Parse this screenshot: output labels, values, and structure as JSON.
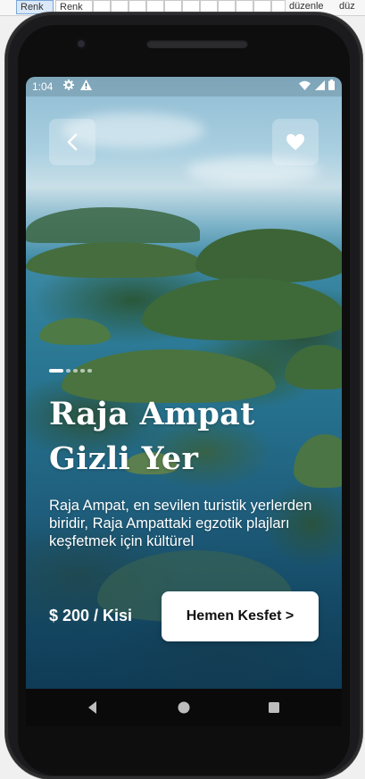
{
  "host": {
    "cells": [
      "Renk",
      "Renk",
      "",
      "",
      "",
      "",
      "",
      "",
      "",
      "",
      "",
      "",
      "",
      "",
      "düzenle",
      "",
      "düz"
    ]
  },
  "status_bar": {
    "time": "1:04",
    "left_icons": [
      "gear-icon",
      "alert-icon"
    ],
    "right_icons": [
      "wifi-icon",
      "signal-icon",
      "battery-icon"
    ]
  },
  "header": {
    "back_icon": "chevron-left-icon",
    "favorite_icon": "heart-icon"
  },
  "carousel": {
    "total": 5,
    "active_index": 0
  },
  "destination": {
    "title": "Raja Ampat Gizli Yer",
    "description": "Raja Ampat, en sevilen turistik yerlerden biridir, Raja Ampattaki egzotik plajları keşfetmek için kültürel",
    "price": "$ 200 / Kisi",
    "cta_label": "Hemen Kesfet >"
  },
  "colors": {
    "cta_bg": "#ffffff",
    "text_on_image": "#ffffff",
    "glass_button": "rgba(255,255,255,0.25)"
  },
  "nav_bar": {
    "icons": [
      "nav-back-icon",
      "nav-home-icon",
      "nav-recents-icon"
    ]
  }
}
